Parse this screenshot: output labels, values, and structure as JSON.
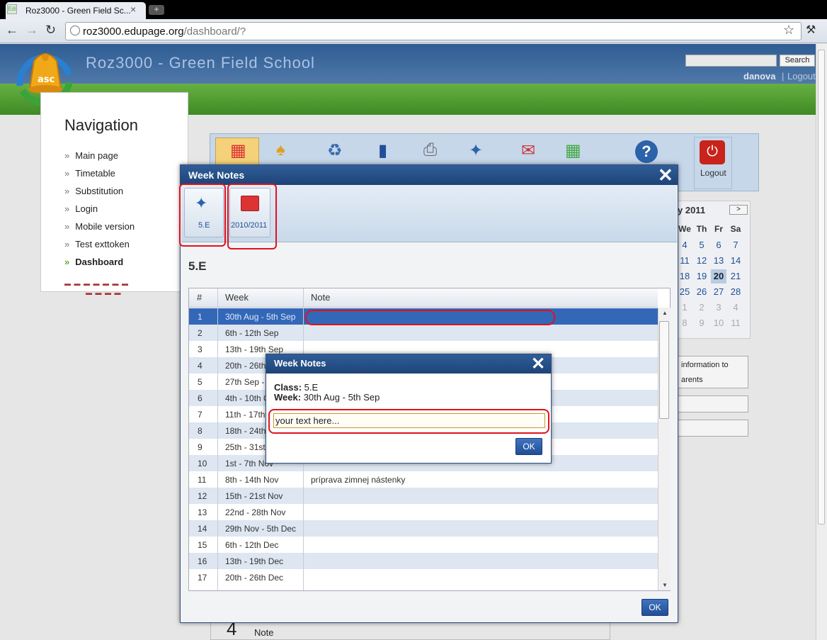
{
  "browser": {
    "tab_title": "Roz3000 - Green Field Sc...",
    "favicon": "Edi",
    "tab_close": "×",
    "new_tab": "+",
    "url_host": "roz3000.edupage.org",
    "url_path": "/dashboard/?",
    "icons": [
      "back-icon",
      "forward-icon",
      "reload-icon",
      "globe-icon",
      "star-icon",
      "wrench-icon"
    ]
  },
  "header": {
    "school_title": "Roz3000 - Green Field School",
    "search_button": "Search",
    "username": "danova",
    "separator": "|",
    "logout_link": "Logout"
  },
  "navigation": {
    "title": "Navigation",
    "items": [
      "Main page",
      "Timetable",
      "Substitution",
      "Login",
      "Mobile version",
      "Test exttoken",
      "Dashboard"
    ],
    "active": "Dashboard",
    "flags_row1": "▬ ▬ ▬ ▬ ▬ ▬ ▬",
    "flags_row2": "▬ ▬ ▬ ▬"
  },
  "toolstrip": {
    "logout_label": "Logout",
    "help_glyph": "?",
    "power_glyph": "⏻"
  },
  "calendar": {
    "month": "y 2011",
    "next": ">",
    "day_headers": [
      "We",
      "Th",
      "Fr",
      "Sa"
    ],
    "weeks": [
      [
        "4",
        "5",
        "6",
        "7"
      ],
      [
        "11",
        "12",
        "13",
        "14"
      ],
      [
        "18",
        "19",
        "20",
        "21"
      ],
      [
        "25",
        "26",
        "27",
        "28"
      ],
      [
        "1",
        "2",
        "3",
        "4"
      ],
      [
        "8",
        "9",
        "10",
        "11"
      ]
    ],
    "today": "20"
  },
  "side_buttons": {
    "info_line1": "information to",
    "info_line2": "arents"
  },
  "below": {
    "number": "4",
    "note": "Note"
  },
  "week_notes_dialog": {
    "title": "Week Notes",
    "close": "✕",
    "class_button_label": "5.E",
    "year_button_label": "2010/2011",
    "class_heading": "5.E",
    "columns": [
      "#",
      "Week",
      "Note"
    ],
    "rows": [
      {
        "num": "1",
        "week": "30th Aug - 5th Sep",
        "note": ""
      },
      {
        "num": "2",
        "week": "6th - 12th Sep",
        "note": ""
      },
      {
        "num": "3",
        "week": "13th - 19th Sep",
        "note": ""
      },
      {
        "num": "4",
        "week": "20th - 26th",
        "note": ""
      },
      {
        "num": "5",
        "week": "27th Sep -",
        "note": ""
      },
      {
        "num": "6",
        "week": "4th - 10th O",
        "note": ""
      },
      {
        "num": "7",
        "week": "11th - 17th",
        "note": ""
      },
      {
        "num": "8",
        "week": "18th - 24th",
        "note": ""
      },
      {
        "num": "9",
        "week": "25th - 31st",
        "note": ""
      },
      {
        "num": "10",
        "week": "1st - 7th Nov",
        "note": ""
      },
      {
        "num": "11",
        "week": "8th - 14th Nov",
        "note": "príprava zimnej nástenky"
      },
      {
        "num": "12",
        "week": "15th - 21st Nov",
        "note": ""
      },
      {
        "num": "13",
        "week": "22nd - 28th Nov",
        "note": ""
      },
      {
        "num": "14",
        "week": "29th Nov - 5th Dec",
        "note": ""
      },
      {
        "num": "15",
        "week": "6th - 12th Dec",
        "note": ""
      },
      {
        "num": "16",
        "week": "13th - 19th Dec",
        "note": ""
      },
      {
        "num": "17",
        "week": "20th - 26th Dec",
        "note": ""
      }
    ],
    "selected_row": "1",
    "ok_button": "OK"
  },
  "note_edit_dialog": {
    "title": "Week Notes",
    "close": "✕",
    "class_label": "Class:",
    "class_value": "5.E",
    "week_label": "Week:",
    "week_value": "30th Aug - 5th Sep",
    "input_value": "your text here...",
    "ok_button": "OK"
  },
  "colors": {
    "header_blue": "#2e5c93",
    "header_green": "#4f9a2e",
    "dialog_bar": "#1e4478",
    "selection": "#3368b8",
    "highlight_red": "#e0121e"
  }
}
